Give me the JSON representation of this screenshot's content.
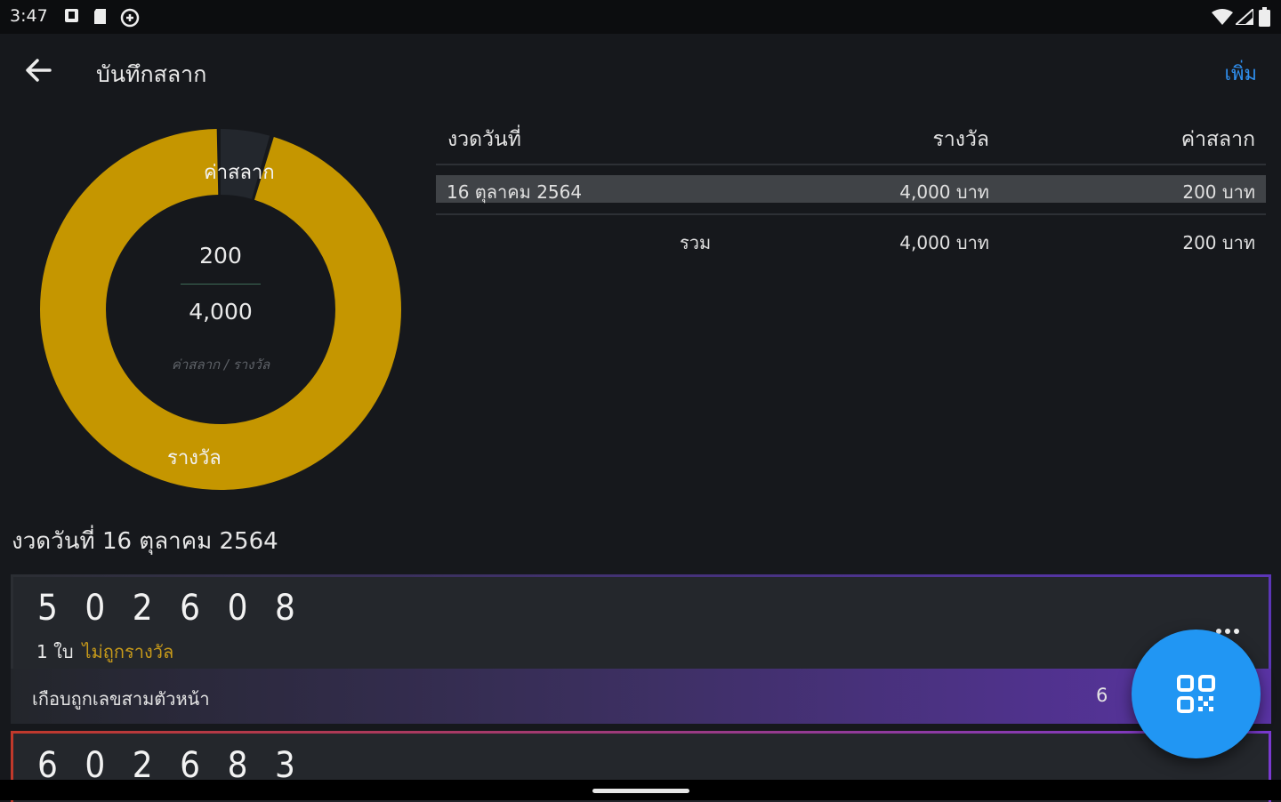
{
  "status_bar": {
    "time": "3:47"
  },
  "app_bar": {
    "title": "บันทึกสลาก",
    "add_label": "เพิ่ม"
  },
  "chart_data": {
    "type": "pie",
    "categories": [
      "ค่าสลาก",
      "รางวัล"
    ],
    "values": [
      200,
      4000
    ],
    "colors": {
      "ค่าสลาก": "#23272d",
      "รางวัล": "#c59600"
    }
  },
  "donut": {
    "cost_label": "ค่าสลาก",
    "prize_label": "รางวัล",
    "center_cost": "200",
    "center_prize": "4,000",
    "caption": "ค่าสลาก / รางวัล"
  },
  "table": {
    "headers": {
      "date": "งวดวันที่",
      "prize": "รางวัล",
      "cost": "ค่าสลาก"
    },
    "rows": [
      {
        "date": "16 ตุลาคม 2564",
        "prize": "4,000 บาท",
        "cost": "200 บาท"
      }
    ],
    "total": {
      "label": "รวม",
      "prize": "4,000 บาท",
      "cost": "200 บาท"
    }
  },
  "section": {
    "title": "งวดวันที่ 16 ตุลาคม 2564"
  },
  "tickets": [
    {
      "digits": [
        "5",
        "0",
        "2",
        "6",
        "0",
        "8"
      ],
      "count": "1 ใบ",
      "status": "ไม่ถูกรางวัล",
      "near_label": "เกือบถูกเลขสามตัวหน้า",
      "near_count": "6"
    },
    {
      "digits": [
        "6",
        "0",
        "2",
        "6",
        "8",
        "3"
      ]
    }
  ],
  "colors": {
    "accent": "#2196f3",
    "gold": "#c59600",
    "background": "#16181c"
  }
}
